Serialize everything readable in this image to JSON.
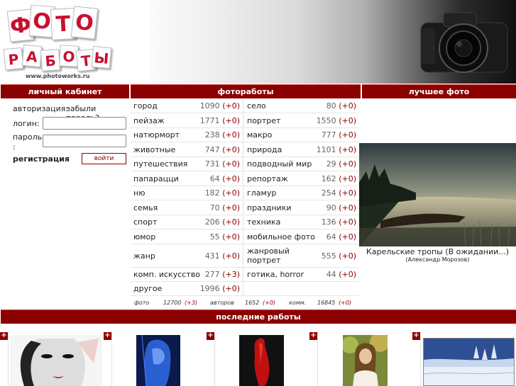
{
  "header": {
    "logo_top": [
      "Ф",
      "О",
      "Т",
      "О"
    ],
    "logo_bottom": [
      "Р",
      "А",
      "Б",
      "О",
      "Т",
      "Ы"
    ],
    "logo_url": "www.photoworks.ru"
  },
  "sections": {
    "cabinet": "личный кабинет",
    "photos": "фотоработы",
    "best": "лучшее фото",
    "latest": "последние работы"
  },
  "cabinet": {
    "auth_label": "авторизация:",
    "forgot_link": "забыли пароль?",
    "login_label": "логин:",
    "password_label": "пароль :",
    "register_link": "регистрация",
    "login_button": "войти",
    "login_value": "",
    "password_value": ""
  },
  "categories": [
    {
      "left": {
        "name": "город",
        "count": "1090",
        "delta": "(+0)"
      },
      "right": {
        "name": "село",
        "count": "80",
        "delta": "(+0)"
      }
    },
    {
      "left": {
        "name": "пейзаж",
        "count": "1771",
        "delta": "(+0)"
      },
      "right": {
        "name": "портрет",
        "count": "1550",
        "delta": "(+0)"
      }
    },
    {
      "left": {
        "name": "натюрморт",
        "count": "238",
        "delta": "(+0)"
      },
      "right": {
        "name": "макро",
        "count": "777",
        "delta": "(+0)"
      }
    },
    {
      "left": {
        "name": "животные",
        "count": "747",
        "delta": "(+0)"
      },
      "right": {
        "name": "природа",
        "count": "1101",
        "delta": "(+0)"
      }
    },
    {
      "left": {
        "name": "путешествия",
        "count": "731",
        "delta": "(+0)"
      },
      "right": {
        "name": "подводный мир",
        "count": "29",
        "delta": "(+0)"
      }
    },
    {
      "left": {
        "name": "папарацци",
        "count": "64",
        "delta": "(+0)"
      },
      "right": {
        "name": "репортаж",
        "count": "162",
        "delta": "(+0)"
      }
    },
    {
      "left": {
        "name": "ню",
        "count": "182",
        "delta": "(+0)"
      },
      "right": {
        "name": "гламур",
        "count": "254",
        "delta": "(+0)"
      }
    },
    {
      "left": {
        "name": "семья",
        "count": "70",
        "delta": "(+0)"
      },
      "right": {
        "name": "праздники",
        "count": "90",
        "delta": "(+0)"
      }
    },
    {
      "left": {
        "name": "спорт",
        "count": "206",
        "delta": "(+0)"
      },
      "right": {
        "name": "техника",
        "count": "136",
        "delta": "(+0)"
      }
    },
    {
      "left": {
        "name": "юмор",
        "count": "55",
        "delta": "(+0)"
      },
      "right": {
        "name": "мобильное фото",
        "count": "64",
        "delta": "(+0)"
      }
    },
    {
      "left": {
        "name": "жанр",
        "count": "431",
        "delta": "(+0)"
      },
      "right": {
        "name": "жанровый портрет",
        "count": "555",
        "delta": "(+0)"
      }
    },
    {
      "left": {
        "name": "комп. искусство",
        "count": "277",
        "delta": "(+3)"
      },
      "right": {
        "name": "готика, horror",
        "count": "44",
        "delta": "(+0)"
      }
    },
    {
      "left": {
        "name": "другое",
        "count": "1996",
        "delta": "(+0)"
      },
      "right": null
    }
  ],
  "stats": {
    "photo_label": "фото",
    "photo_count": "12700",
    "photo_delta": "(+3)",
    "authors_label": "авторов",
    "authors_count": "1652",
    "authors_delta": "(+0)",
    "comments_label": "комм.",
    "comments_count": "16845",
    "comments_delta": "(+0)"
  },
  "best_photo": {
    "title": "Карельские тропы (В ожидании...)",
    "author": "(Александр Морозов)"
  },
  "latest": {
    "plus_symbol": "+"
  },
  "colors": {
    "brand": "#8b0000",
    "logo_red": "#c8102e"
  }
}
